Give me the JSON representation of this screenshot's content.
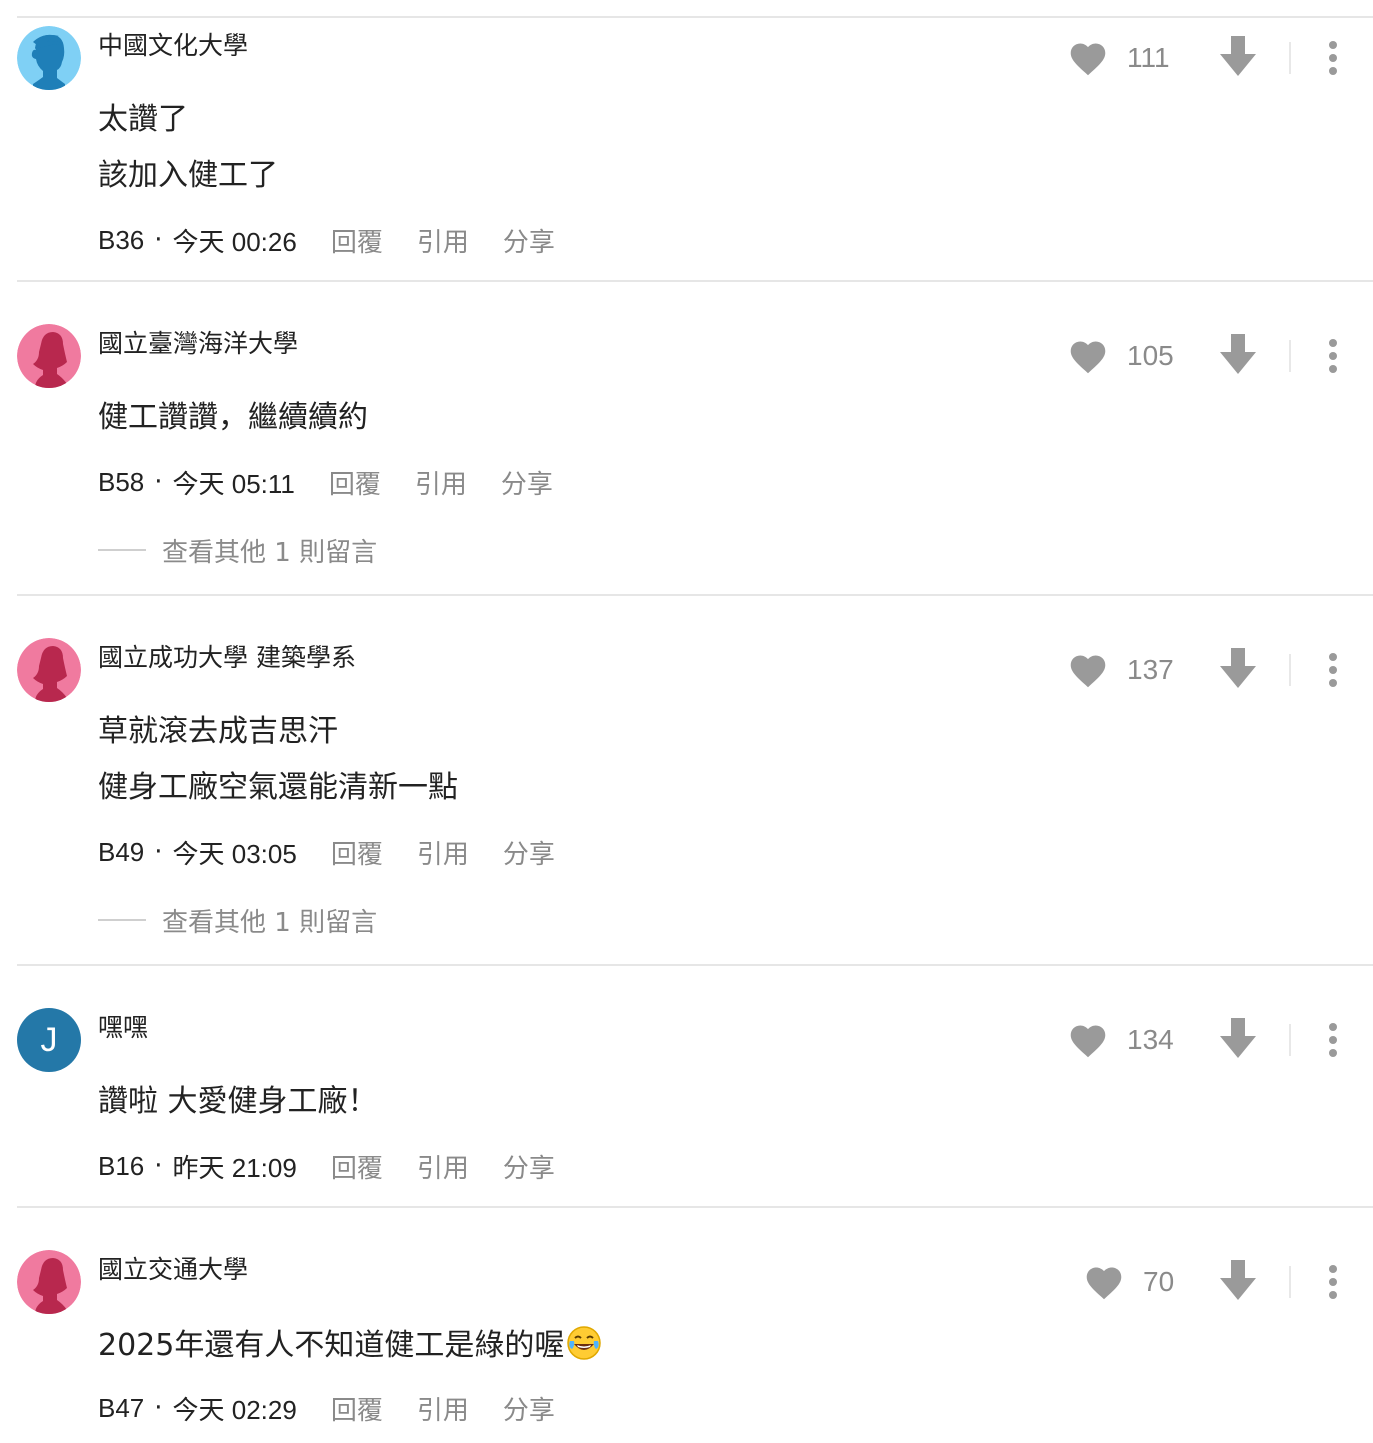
{
  "comments": [
    {
      "author": "中國文化大學",
      "avatar": "male-avatar-icon",
      "avatar_color": "#7fd0f5",
      "lines": [
        "太讚了",
        "該加入健工了"
      ],
      "floor": "B36",
      "time": "今天 00:26",
      "likes": "111",
      "more_replies": null
    },
    {
      "author": "國立臺灣海洋大學",
      "avatar": "female-avatar-icon",
      "avatar_color": "#f07a9f",
      "lines": [
        "健工讚讚，繼續續約"
      ],
      "floor": "B58",
      "time": "今天 05:11",
      "likes": "105",
      "more_replies": "查看其他 1 則留言"
    },
    {
      "author": "國立成功大學 建築學系",
      "avatar": "female-avatar-icon",
      "avatar_color": "#f07a9f",
      "lines": [
        "草就滾去成吉思汗",
        "健身工廠空氣還能清新一點"
      ],
      "floor": "B49",
      "time": "今天 03:05",
      "likes": "137",
      "more_replies": "查看其他 1 則留言"
    },
    {
      "author": "嘿嘿",
      "avatar": "letter-avatar",
      "avatar_letter": "J",
      "avatar_color": "#2478a8",
      "lines": [
        "讚啦 大愛健身工廠！"
      ],
      "floor": "B16",
      "time": "昨天 21:09",
      "likes": "134",
      "more_replies": null
    },
    {
      "author": "國立交通大學",
      "avatar": "female-avatar-icon",
      "avatar_color": "#f07a9f",
      "lines": [
        "2025年還有人不知道健工是綠的喔"
      ],
      "emoji": "tears-of-joy-emoji",
      "floor": "B47",
      "time": "今天 02:29",
      "likes": "70",
      "more_replies": null
    }
  ],
  "actions": {
    "reply": "回覆",
    "quote": "引用",
    "share": "分享"
  },
  "separator_dot": "·",
  "colors": {
    "muted": "#8a8a8a",
    "icon": "#9a9a9a",
    "divider": "#e6e6e6",
    "text": "#222222"
  }
}
